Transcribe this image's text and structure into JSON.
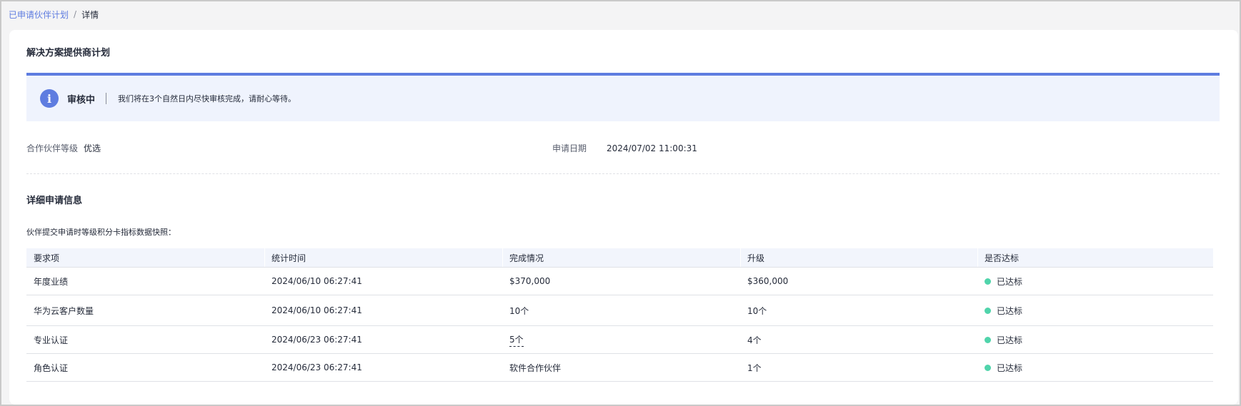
{
  "breadcrumb": {
    "parent": "已申请伙伴计划",
    "separator": "/",
    "current": "详情"
  },
  "page": {
    "title": "解决方案提供商计划"
  },
  "alert": {
    "icon": "info-icon",
    "icon_glyph": "i",
    "status": "审核中",
    "message": "我们将在3个自然日内尽快审核完成，请耐心等待。",
    "accent_color": "#5e7ce0"
  },
  "info": {
    "partner_level_label": "合作伙伴等级",
    "partner_level_value": "优选",
    "apply_date_label": "申请日期",
    "apply_date_value": "2024/07/02 11:00:31"
  },
  "details": {
    "title": "详细申请信息",
    "snapshot_note": "伙伴提交申请时等级积分卡指标数据快照："
  },
  "table": {
    "headers": [
      "要求项",
      "统计时间",
      "完成情况",
      "升级",
      "是否达标"
    ],
    "rows": [
      {
        "item": "年度业绩",
        "time": "2024/06/10 06:27:41",
        "completion": "$370,000",
        "upgrade": "$360,000",
        "status": "已达标"
      },
      {
        "item": "华为云客户数量",
        "time": "2024/06/10 06:27:41",
        "completion": "10个",
        "upgrade": "10个",
        "status": "已达标"
      },
      {
        "item": "专业认证",
        "time": "2024/06/23 06:27:41",
        "completion": "5个",
        "upgrade": "4个",
        "status": "已达标"
      },
      {
        "item": "角色认证",
        "time": "2024/06/23 06:27:41",
        "completion": "软件合作伙伴",
        "upgrade": "1个",
        "status": "已达标"
      }
    ],
    "status_color": "#50d4ab"
  }
}
